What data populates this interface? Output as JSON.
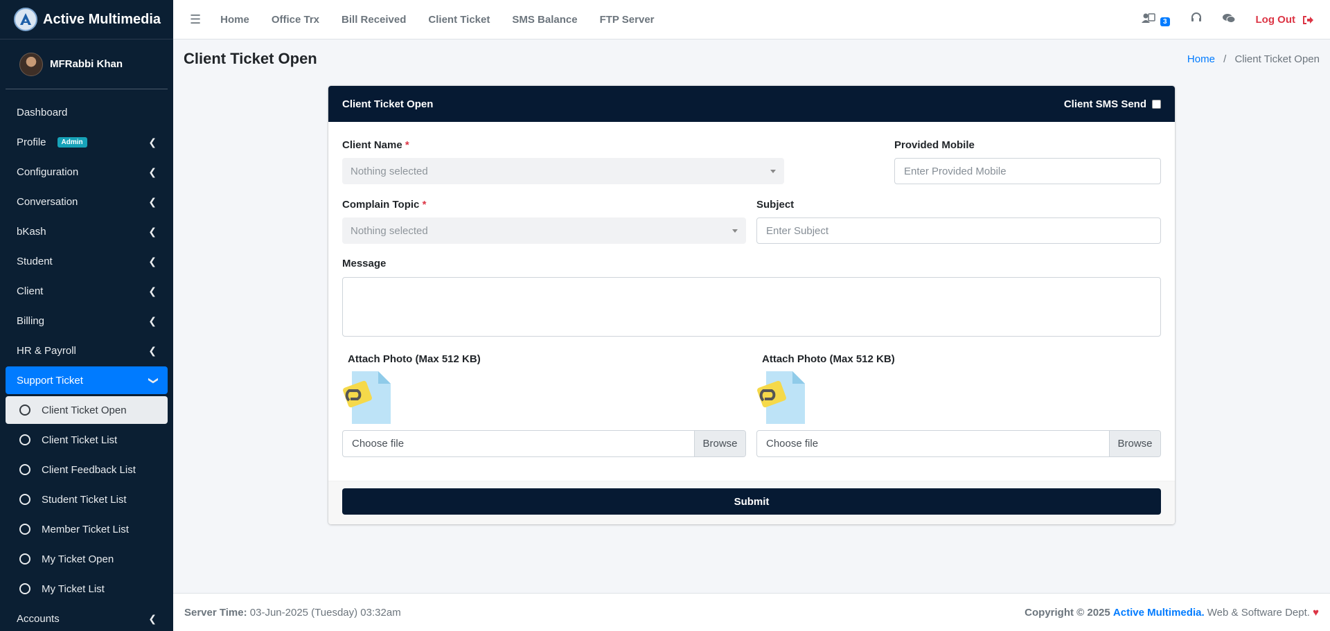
{
  "brand": {
    "name": "Active Multimedia"
  },
  "user": {
    "name": "MFRabbi Khan"
  },
  "sidebar": {
    "items": [
      {
        "label": "Dashboard"
      },
      {
        "label": "Profile",
        "badge": "Admin"
      },
      {
        "label": "Configuration"
      },
      {
        "label": "Conversation"
      },
      {
        "label": "bKash"
      },
      {
        "label": "Student"
      },
      {
        "label": "Client"
      },
      {
        "label": "Billing"
      },
      {
        "label": "HR & Payroll"
      },
      {
        "label": "Support Ticket"
      }
    ],
    "sub_items": [
      {
        "label": "Client Ticket Open"
      },
      {
        "label": "Client Ticket List"
      },
      {
        "label": "Client Feedback List"
      },
      {
        "label": "Student Ticket List"
      },
      {
        "label": "Member Ticket List"
      },
      {
        "label": "My Ticket Open"
      },
      {
        "label": "My Ticket List"
      }
    ],
    "after_items": [
      {
        "label": "Accounts"
      }
    ]
  },
  "topnav": {
    "links": [
      "Home",
      "Office Trx",
      "Bill Received",
      "Client Ticket",
      "SMS Balance",
      "FTP Server"
    ],
    "notification_count": "3",
    "logout_label": "Log Out"
  },
  "page": {
    "title": "Client Ticket Open",
    "breadcrumb": {
      "home": "Home",
      "sep": "/",
      "current": "Client Ticket Open"
    }
  },
  "form": {
    "header_title": "Client Ticket Open",
    "sms_send_label": "Client SMS Send",
    "client_name_label": "Client Name",
    "client_name_value": "Nothing selected",
    "mobile_label": "Provided Mobile",
    "mobile_placeholder": "Enter Provided Mobile",
    "topic_label": "Complain Topic",
    "topic_value": "Nothing selected",
    "subject_label": "Subject",
    "subject_placeholder": "Enter Subject",
    "message_label": "Message",
    "required_mark": "*",
    "attach1_label": "Attach Photo (Max 512 KB)",
    "attach2_label": "Attach Photo (Max 512 KB)",
    "choose_file": "Choose file",
    "browse": "Browse",
    "submit_label": "Submit"
  },
  "footer": {
    "server_time_label": "Server Time:",
    "server_time_value": "03-Jun-2025 (Tuesday) 03:32am",
    "copyright": "Copyright © 2025",
    "company": "Active Multimedia.",
    "dept": "Web & Software Dept."
  },
  "colors": {
    "sidebar_bg": "#0b1f33",
    "active_blue": "#007bff",
    "header_navy": "#061a33",
    "danger": "#dc3545"
  }
}
